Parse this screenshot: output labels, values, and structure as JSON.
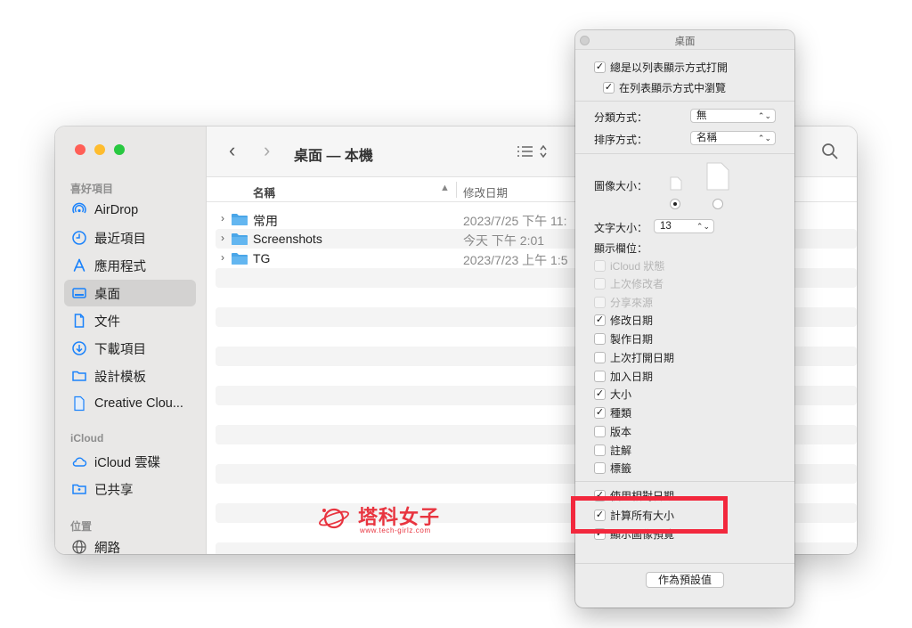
{
  "finder": {
    "traffic_lights": {
      "close": "#ff5f57",
      "minimize": "#febc2e",
      "zoom": "#28c840"
    },
    "sidebar": {
      "favorites_heading": "喜好項目",
      "favorites": [
        {
          "label": "AirDrop",
          "icon": "airdrop-icon"
        },
        {
          "label": "最近項目",
          "icon": "clock-icon"
        },
        {
          "label": "應用程式",
          "icon": "apps-icon"
        },
        {
          "label": "桌面",
          "icon": "desktop-icon",
          "selected": true
        },
        {
          "label": "文件",
          "icon": "document-icon"
        },
        {
          "label": "下載項目",
          "icon": "download-icon"
        },
        {
          "label": "設計模板",
          "icon": "folder-icon"
        },
        {
          "label": "Creative Clou...",
          "icon": "file-icon"
        }
      ],
      "icloud_heading": "iCloud",
      "icloud": [
        {
          "label": "iCloud 雲碟",
          "icon": "cloud-icon"
        },
        {
          "label": "已共享",
          "icon": "shared-folder-icon"
        }
      ],
      "locations_heading": "位置",
      "locations": [
        {
          "label": "網路",
          "icon": "globe-icon"
        }
      ]
    },
    "toolbar": {
      "title": "桌面 — 本機"
    },
    "list_header": {
      "name": "名稱",
      "date_modified": "修改日期"
    },
    "files": [
      {
        "name": "常用",
        "date": "2023/7/25 下午 11:"
      },
      {
        "name": "Screenshots",
        "date": "今天 下午 2:01"
      },
      {
        "name": "TG",
        "date": "2023/7/23 上午 1:5"
      }
    ],
    "folder_color": "#4aa6e8",
    "accent_color": "#1a82fb"
  },
  "panel": {
    "title": "桌面",
    "always_open_list": "總是以列表顯示方式打開",
    "browse_in_list": "在列表顯示方式中瀏覽",
    "group_by_label": "分類方式：",
    "group_by_value": "無",
    "sort_by_label": "排序方式：",
    "sort_by_value": "名稱",
    "icon_size_label": "圖像大小：",
    "icon_size_selection": "small",
    "text_size_label": "文字大小：",
    "text_size_value": "13",
    "show_columns_label": "顯示欄位：",
    "columns": [
      {
        "label": "iCloud 狀態",
        "checked": false,
        "disabled": true
      },
      {
        "label": "上次修改者",
        "checked": false,
        "disabled": true
      },
      {
        "label": "分享來源",
        "checked": false,
        "disabled": true
      },
      {
        "label": "修改日期",
        "checked": true,
        "disabled": false
      },
      {
        "label": "製作日期",
        "checked": false,
        "disabled": false
      },
      {
        "label": "上次打開日期",
        "checked": false,
        "disabled": false
      },
      {
        "label": "加入日期",
        "checked": false,
        "disabled": false
      },
      {
        "label": "大小",
        "checked": true,
        "disabled": false
      },
      {
        "label": "種類",
        "checked": true,
        "disabled": false
      },
      {
        "label": "版本",
        "checked": false,
        "disabled": false
      },
      {
        "label": "註解",
        "checked": false,
        "disabled": false
      },
      {
        "label": "標籤",
        "checked": false,
        "disabled": false
      }
    ],
    "use_relative_dates": "使用相對日期",
    "calculate_all_sizes": "計算所有大小",
    "show_icon_preview": "顯示圖像預覽",
    "use_as_defaults": "作為預設值"
  },
  "highlight_color": "#f2283d",
  "watermark": {
    "brand": "塔科女子",
    "url": "www.tech-girlz.com",
    "color": "#e8343f"
  }
}
